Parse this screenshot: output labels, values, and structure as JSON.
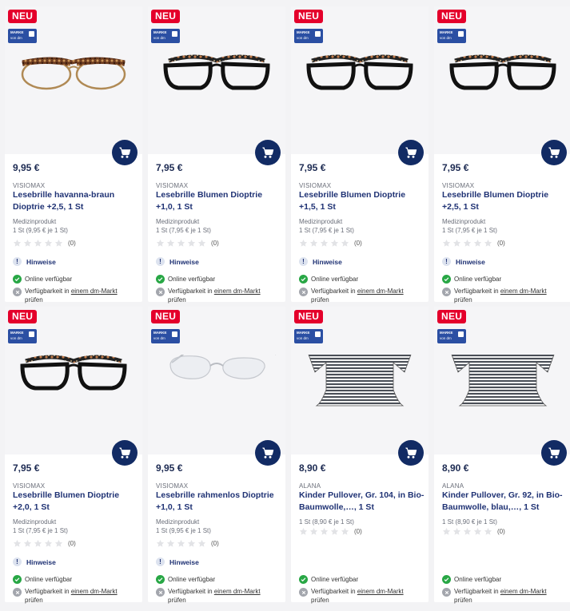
{
  "colors": {
    "brand_blue": "#1f3274",
    "cart_blue": "#122b64",
    "neu_red": "#e4002b",
    "ok_green": "#28a745"
  },
  "products": [
    {
      "neu": "NEU",
      "marke_top": "MARKE",
      "marke_bottom": "von dm",
      "price": "9,95 €",
      "brand": "VISIOMAX",
      "title": "Lesebrille havanna-braun Dioptrie +2,5, 1 St",
      "category": "Medizinprodukt",
      "unit": "1 St (9,95 € je 1 St)",
      "rating_count": "(0)",
      "hinweise": "Hinweise",
      "online": "Online verfügbar",
      "store_pre": "Verfügbarkeit in ",
      "store_link": "einem dm-Markt",
      "store_post": "prüfen",
      "image": "glasses-havanna-icon"
    },
    {
      "neu": "NEU",
      "marke_top": "MARKE",
      "marke_bottom": "von dm",
      "price": "7,95 €",
      "brand": "VISIOMAX",
      "title": "Lesebrille Blumen Dioptrie +1,0, 1 St",
      "category": "Medizinprodukt",
      "unit": "1 St (7,95 € je 1 St)",
      "rating_count": "(0)",
      "hinweise": "Hinweise",
      "online": "Online verfügbar",
      "store_pre": "Verfügbarkeit in ",
      "store_link": "einem dm-Markt",
      "store_post": "prüfen",
      "image": "glasses-black-icon"
    },
    {
      "neu": "NEU",
      "marke_top": "MARKE",
      "marke_bottom": "von dm",
      "price": "7,95 €",
      "brand": "VISIOMAX",
      "title": "Lesebrille Blumen Dioptrie +1,5, 1 St",
      "category": "Medizinprodukt",
      "unit": "1 St (7,95 € je 1 St)",
      "rating_count": "(0)",
      "hinweise": "Hinweise",
      "online": "Online verfügbar",
      "store_pre": "Verfügbarkeit in ",
      "store_link": "einem dm-Markt",
      "store_post": "prüfen",
      "image": "glasses-black-icon"
    },
    {
      "neu": "NEU",
      "marke_top": "MARKE",
      "marke_bottom": "von dm",
      "price": "7,95 €",
      "brand": "VISIOMAX",
      "title": "Lesebrille Blumen Dioptrie +2,5, 1 St",
      "category": "Medizinprodukt",
      "unit": "1 St (7,95 € je 1 St)",
      "rating_count": "(0)",
      "hinweise": "Hinweise",
      "online": "Online verfügbar",
      "store_pre": "Verfügbarkeit in ",
      "store_link": "einem dm-Markt",
      "store_post": "prüfen",
      "image": "glasses-black-icon"
    },
    {
      "neu": "NEU",
      "marke_top": "MARKE",
      "marke_bottom": "von dm",
      "price": "7,95 €",
      "brand": "VISIOMAX",
      "title": "Lesebrille Blumen Dioptrie +2,0, 1 St",
      "category": "Medizinprodukt",
      "unit": "1 St (7,95 € je 1 St)",
      "rating_count": "(0)",
      "hinweise": "Hinweise",
      "online": "Online verfügbar",
      "store_pre": "Verfügbarkeit in ",
      "store_link": "einem dm-Markt",
      "store_post": "prüfen",
      "image": "glasses-black-icon"
    },
    {
      "neu": "NEU",
      "marke_top": "MARKE",
      "marke_bottom": "von dm",
      "price": "9,95 €",
      "brand": "VISIOMAX",
      "title": "Lesebrille rahmenlos Dioptrie +1,0, 1 St",
      "category": "Medizinprodukt",
      "unit": "1 St (9,95 € je 1 St)",
      "rating_count": "(0)",
      "hinweise": "Hinweise",
      "online": "Online verfügbar",
      "store_pre": "Verfügbarkeit in ",
      "store_link": "einem dm-Markt",
      "store_post": "prüfen",
      "image": "glasses-rimless-icon"
    },
    {
      "neu": "NEU",
      "marke_top": "MARKE",
      "marke_bottom": "von dm",
      "price": "8,90 €",
      "brand": "ALANA",
      "title": "Kinder Pullover, Gr. 104, in Bio-Baumwolle,…, 1 St",
      "category": "",
      "unit": "1 St (8,90 € je 1 St)",
      "rating_count": "(0)",
      "hinweise": "",
      "online": "Online verfügbar",
      "store_pre": "Verfügbarkeit in ",
      "store_link": "einem dm-Markt",
      "store_post": "prüfen",
      "image": "striped-pullover-icon"
    },
    {
      "neu": "NEU",
      "marke_top": "MARKE",
      "marke_bottom": "von dm",
      "price": "8,90 €",
      "brand": "ALANA",
      "title": "Kinder Pullover, Gr. 92, in Bio-Baumwolle, blau,…, 1 St",
      "category": "",
      "unit": "1 St (8,90 € je 1 St)",
      "rating_count": "(0)",
      "hinweise": "",
      "online": "Online verfügbar",
      "store_pre": "Verfügbarkeit in ",
      "store_link": "einem dm-Markt",
      "store_post": "prüfen",
      "image": "striped-pullover-icon"
    }
  ]
}
